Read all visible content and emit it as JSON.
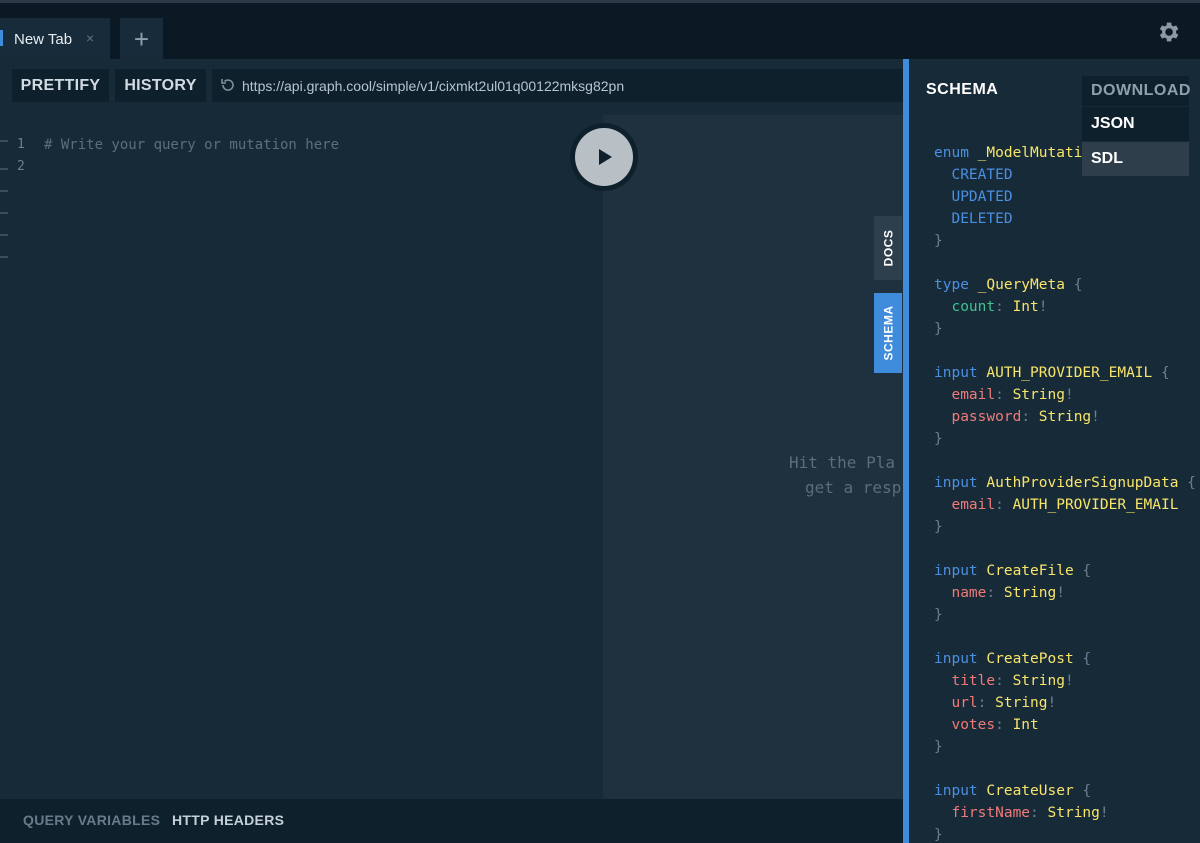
{
  "tabs": [
    {
      "label": "New Tab",
      "close": "×"
    }
  ],
  "new_tab_symbol": "+",
  "toolbar": {
    "prettify": "PRETTIFY",
    "history": "HISTORY",
    "endpoint": "https://api.graph.cool/simple/v1/cixmkt2ul01q00122mksg82pn"
  },
  "editor": {
    "line_numbers": [
      "1",
      "2"
    ],
    "lines": [
      "# Write your query or mutation here",
      ""
    ]
  },
  "result_hint": [
    "Hit the Pla",
    "get a resp"
  ],
  "side_tabs": {
    "docs": "DOCS",
    "schema": "SCHEMA"
  },
  "bottom": {
    "query_variables": "QUERY VARIABLES",
    "http_headers": "HTTP HEADERS"
  },
  "schema": {
    "title": "SCHEMA",
    "download": {
      "label": "DOWNLOAD",
      "options": [
        "JSON",
        "SDL"
      ]
    },
    "sdl": [
      {
        "kind": "enum",
        "name": "_ModelMutati",
        "members": [
          "CREATED",
          "UPDATED",
          "DELETED"
        ]
      },
      {
        "kind": "type",
        "name": "_QueryMeta",
        "fields": [
          {
            "name": "count",
            "type": "Int",
            "bang": "!"
          }
        ]
      },
      {
        "kind": "input",
        "name": "AUTH_PROVIDER_EMAIL",
        "fields": [
          {
            "name": "email",
            "type": "String",
            "bang": "!"
          },
          {
            "name": "password",
            "type": "String",
            "bang": "!"
          }
        ]
      },
      {
        "kind": "input",
        "name": "AuthProviderSignupData",
        "fields": [
          {
            "name": "email",
            "type": "AUTH_PROVIDER_EMAIL",
            "bang": ""
          }
        ]
      },
      {
        "kind": "input",
        "name": "CreateFile",
        "fields": [
          {
            "name": "name",
            "type": "String",
            "bang": "!"
          }
        ]
      },
      {
        "kind": "input",
        "name": "CreatePost",
        "fields": [
          {
            "name": "title",
            "type": "String",
            "bang": "!"
          },
          {
            "name": "url",
            "type": "String",
            "bang": "!"
          },
          {
            "name": "votes",
            "type": "Int",
            "bang": ""
          }
        ]
      },
      {
        "kind": "input",
        "name": "CreateUser",
        "fields": [
          {
            "name": "firstName",
            "type": "String",
            "bang": "!"
          }
        ]
      }
    ]
  },
  "colors": {
    "accent": "#3f8bdc",
    "keyword": "#4b8fe2",
    "type_name": "#f8e56a",
    "field": "#f07a79",
    "scalar_count": "#40c291"
  }
}
